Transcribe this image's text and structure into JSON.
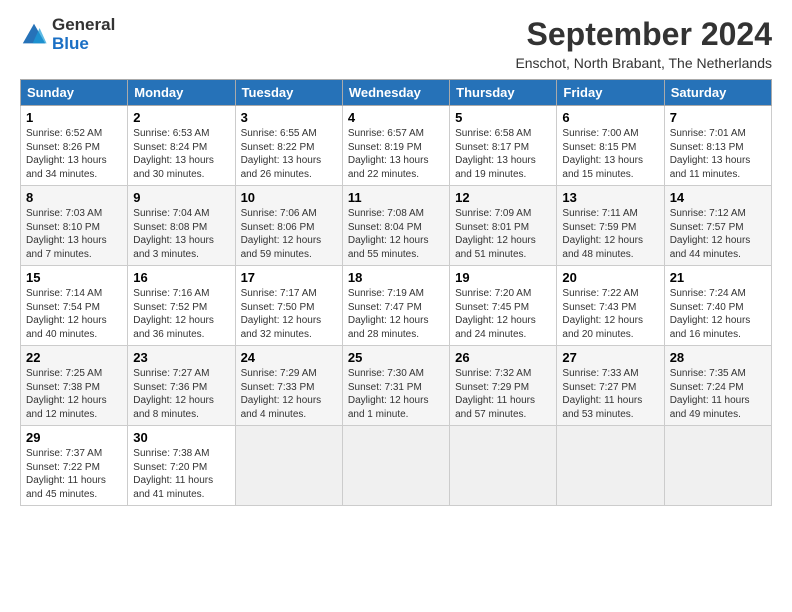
{
  "logo": {
    "general": "General",
    "blue": "Blue"
  },
  "title": "September 2024",
  "location": "Enschot, North Brabant, The Netherlands",
  "weekdays": [
    "Sunday",
    "Monday",
    "Tuesday",
    "Wednesday",
    "Thursday",
    "Friday",
    "Saturday"
  ],
  "weeks": [
    [
      {
        "day": "1",
        "rise": "6:52 AM",
        "set": "8:26 PM",
        "daylight": "13 hours and 34 minutes."
      },
      {
        "day": "2",
        "rise": "6:53 AM",
        "set": "8:24 PM",
        "daylight": "13 hours and 30 minutes."
      },
      {
        "day": "3",
        "rise": "6:55 AM",
        "set": "8:22 PM",
        "daylight": "13 hours and 26 minutes."
      },
      {
        "day": "4",
        "rise": "6:57 AM",
        "set": "8:19 PM",
        "daylight": "13 hours and 22 minutes."
      },
      {
        "day": "5",
        "rise": "6:58 AM",
        "set": "8:17 PM",
        "daylight": "13 hours and 19 minutes."
      },
      {
        "day": "6",
        "rise": "7:00 AM",
        "set": "8:15 PM",
        "daylight": "13 hours and 15 minutes."
      },
      {
        "day": "7",
        "rise": "7:01 AM",
        "set": "8:13 PM",
        "daylight": "13 hours and 11 minutes."
      }
    ],
    [
      {
        "day": "8",
        "rise": "7:03 AM",
        "set": "8:10 PM",
        "daylight": "13 hours and 7 minutes."
      },
      {
        "day": "9",
        "rise": "7:04 AM",
        "set": "8:08 PM",
        "daylight": "13 hours and 3 minutes."
      },
      {
        "day": "10",
        "rise": "7:06 AM",
        "set": "8:06 PM",
        "daylight": "12 hours and 59 minutes."
      },
      {
        "day": "11",
        "rise": "7:08 AM",
        "set": "8:04 PM",
        "daylight": "12 hours and 55 minutes."
      },
      {
        "day": "12",
        "rise": "7:09 AM",
        "set": "8:01 PM",
        "daylight": "12 hours and 51 minutes."
      },
      {
        "day": "13",
        "rise": "7:11 AM",
        "set": "7:59 PM",
        "daylight": "12 hours and 48 minutes."
      },
      {
        "day": "14",
        "rise": "7:12 AM",
        "set": "7:57 PM",
        "daylight": "12 hours and 44 minutes."
      }
    ],
    [
      {
        "day": "15",
        "rise": "7:14 AM",
        "set": "7:54 PM",
        "daylight": "12 hours and 40 minutes."
      },
      {
        "day": "16",
        "rise": "7:16 AM",
        "set": "7:52 PM",
        "daylight": "12 hours and 36 minutes."
      },
      {
        "day": "17",
        "rise": "7:17 AM",
        "set": "7:50 PM",
        "daylight": "12 hours and 32 minutes."
      },
      {
        "day": "18",
        "rise": "7:19 AM",
        "set": "7:47 PM",
        "daylight": "12 hours and 28 minutes."
      },
      {
        "day": "19",
        "rise": "7:20 AM",
        "set": "7:45 PM",
        "daylight": "12 hours and 24 minutes."
      },
      {
        "day": "20",
        "rise": "7:22 AM",
        "set": "7:43 PM",
        "daylight": "12 hours and 20 minutes."
      },
      {
        "day": "21",
        "rise": "7:24 AM",
        "set": "7:40 PM",
        "daylight": "12 hours and 16 minutes."
      }
    ],
    [
      {
        "day": "22",
        "rise": "7:25 AM",
        "set": "7:38 PM",
        "daylight": "12 hours and 12 minutes."
      },
      {
        "day": "23",
        "rise": "7:27 AM",
        "set": "7:36 PM",
        "daylight": "12 hours and 8 minutes."
      },
      {
        "day": "24",
        "rise": "7:29 AM",
        "set": "7:33 PM",
        "daylight": "12 hours and 4 minutes."
      },
      {
        "day": "25",
        "rise": "7:30 AM",
        "set": "7:31 PM",
        "daylight": "12 hours and 1 minute."
      },
      {
        "day": "26",
        "rise": "7:32 AM",
        "set": "7:29 PM",
        "daylight": "11 hours and 57 minutes."
      },
      {
        "day": "27",
        "rise": "7:33 AM",
        "set": "7:27 PM",
        "daylight": "11 hours and 53 minutes."
      },
      {
        "day": "28",
        "rise": "7:35 AM",
        "set": "7:24 PM",
        "daylight": "11 hours and 49 minutes."
      }
    ],
    [
      {
        "day": "29",
        "rise": "7:37 AM",
        "set": "7:22 PM",
        "daylight": "11 hours and 45 minutes."
      },
      {
        "day": "30",
        "rise": "7:38 AM",
        "set": "7:20 PM",
        "daylight": "11 hours and 41 minutes."
      },
      null,
      null,
      null,
      null,
      null
    ]
  ]
}
